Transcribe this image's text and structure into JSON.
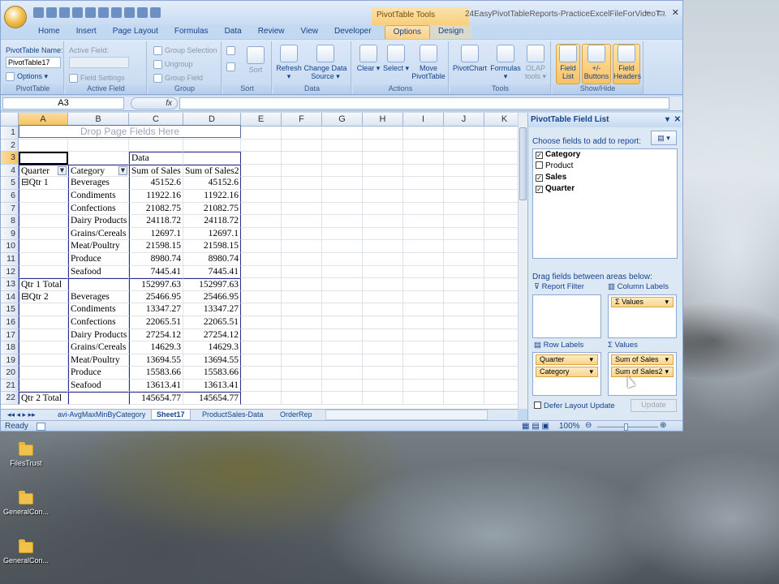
{
  "window": {
    "title": "24EasyPivotTableReports-PracticeExcelFileForVideoT...",
    "context_tab_group": "PivotTable Tools",
    "controls": [
      "–",
      "▭",
      "✕"
    ]
  },
  "tabs": [
    "Home",
    "Insert",
    "Page Layout",
    "Formulas",
    "Data",
    "Review",
    "View",
    "Developer",
    "Options",
    "Design"
  ],
  "ribbon": {
    "pivottable": {
      "name_label": "PivotTable Name:",
      "name_value": "PivotTable17",
      "options": "Options",
      "group": "PivotTable"
    },
    "active_field": {
      "label": "Active Field:",
      "field_settings": "Field Settings",
      "group": "Active Field"
    },
    "group": {
      "selection": "Group Selection",
      "ungroup": "Ungroup",
      "field": "Group Field",
      "group": "Group"
    },
    "sort": {
      "sort": "Sort",
      "group": "Sort"
    },
    "data": {
      "refresh": "Refresh",
      "change_source_1": "Change Data",
      "change_source_2": "Source",
      "group": "Data"
    },
    "actions": {
      "clear": "Clear",
      "select": "Select",
      "move_1": "Move",
      "move_2": "PivotTable",
      "group": "Actions"
    },
    "tools": {
      "pivotchart": "PivotChart",
      "formulas": "Formulas",
      "olap_1": "OLAP",
      "olap_2": "tools",
      "group": "Tools"
    },
    "showhide": {
      "field_list_1": "Field",
      "field_list_2": "List",
      "buttons_1": "+/-",
      "buttons_2": "Buttons",
      "headers_1": "Field",
      "headers_2": "Headers",
      "group": "Show/Hide"
    }
  },
  "formula_bar": {
    "cell": "A3",
    "fx": "fx",
    "value": ""
  },
  "columns": [
    {
      "label": "A",
      "sel": true
    },
    {
      "label": "B",
      "sel": false
    },
    {
      "label": "C",
      "sel": false
    },
    {
      "label": "D",
      "sel": false
    },
    {
      "label": "E",
      "sel": false
    },
    {
      "label": "F",
      "sel": false
    },
    {
      "label": "G",
      "sel": false
    },
    {
      "label": "H",
      "sel": false
    },
    {
      "label": "I",
      "sel": false
    },
    {
      "label": "J",
      "sel": false
    },
    {
      "label": "K",
      "sel": false
    }
  ],
  "drop_zone": "Drop Page Fields Here",
  "pivot_rows": [
    {
      "row": "1",
      "a": "",
      "b": "",
      "c": "",
      "d": ""
    },
    {
      "row": "2",
      "a": "",
      "b": "",
      "c": "",
      "d": ""
    },
    {
      "row": "3",
      "a": "",
      "b": "",
      "c": "Data",
      "d": ""
    },
    {
      "row": "4",
      "a": "Quarter",
      "b": "Category",
      "c": "Sum of Sales",
      "d": "Sum of Sales2"
    },
    {
      "row": "5",
      "a": "⊟Qtr 1",
      "b": "Beverages",
      "c": "45152.6",
      "d": "45152.6"
    },
    {
      "row": "6",
      "a": "",
      "b": "Condiments",
      "c": "11922.16",
      "d": "11922.16"
    },
    {
      "row": "7",
      "a": "",
      "b": "Confections",
      "c": "21082.75",
      "d": "21082.75"
    },
    {
      "row": "8",
      "a": "",
      "b": "Dairy Products",
      "c": "24118.72",
      "d": "24118.72"
    },
    {
      "row": "9",
      "a": "",
      "b": "Grains/Cereals",
      "c": "12697.1",
      "d": "12697.1"
    },
    {
      "row": "10",
      "a": "",
      "b": "Meat/Poultry",
      "c": "21598.15",
      "d": "21598.15"
    },
    {
      "row": "11",
      "a": "",
      "b": "Produce",
      "c": "8980.74",
      "d": "8980.74"
    },
    {
      "row": "12",
      "a": "",
      "b": "Seafood",
      "c": "7445.41",
      "d": "7445.41"
    },
    {
      "row": "13",
      "a": "Qtr 1 Total",
      "b": "",
      "c": "152997.63",
      "d": "152997.63"
    },
    {
      "row": "14",
      "a": "⊟Qtr 2",
      "b": "Beverages",
      "c": "25466.95",
      "d": "25466.95"
    },
    {
      "row": "15",
      "a": "",
      "b": "Condiments",
      "c": "13347.27",
      "d": "13347.27"
    },
    {
      "row": "16",
      "a": "",
      "b": "Confections",
      "c": "22065.51",
      "d": "22065.51"
    },
    {
      "row": "17",
      "a": "",
      "b": "Dairy Products",
      "c": "27254.12",
      "d": "27254.12"
    },
    {
      "row": "18",
      "a": "",
      "b": "Grains/Cereals",
      "c": "14629.3",
      "d": "14629.3"
    },
    {
      "row": "19",
      "a": "",
      "b": "Meat/Poultry",
      "c": "13694.55",
      "d": "13694.55"
    },
    {
      "row": "20",
      "a": "",
      "b": "Produce",
      "c": "15583.66",
      "d": "15583.66"
    },
    {
      "row": "21",
      "a": "",
      "b": "Seafood",
      "c": "13613.41",
      "d": "13613.41"
    },
    {
      "row": "22",
      "a": "Qtr 2 Total",
      "b": "",
      "c": "145654.77",
      "d": "145654.77"
    }
  ],
  "sheet_tabs": [
    "avi-AvgMaxMinByCategory",
    "Sheet17",
    "ProductSales-Data",
    "OrderRep"
  ],
  "status": {
    "ready": "Ready",
    "zoom": "100%"
  },
  "field_list": {
    "title": "PivotTable Field List",
    "choose": "Choose fields to add to report:",
    "fields": [
      {
        "name": "Category",
        "checked": true
      },
      {
        "name": "Product",
        "checked": false
      },
      {
        "name": "Sales",
        "checked": true
      },
      {
        "name": "Quarter",
        "checked": true
      }
    ],
    "drag_label": "Drag fields between areas below:",
    "report_filter": "Report Filter",
    "column_labels": "Column Labels",
    "row_labels": "Row Labels",
    "values": "Values",
    "column_items": [
      "Σ Values"
    ],
    "row_items": [
      "Quarter",
      "Category"
    ],
    "value_items": [
      "Sum of Sales",
      "Sum of Sales2"
    ],
    "defer": "Defer Layout Update",
    "update": "Update"
  },
  "desktop_icons": [
    "FilesTrust",
    "GeneralCon...",
    "GeneralCon..."
  ]
}
